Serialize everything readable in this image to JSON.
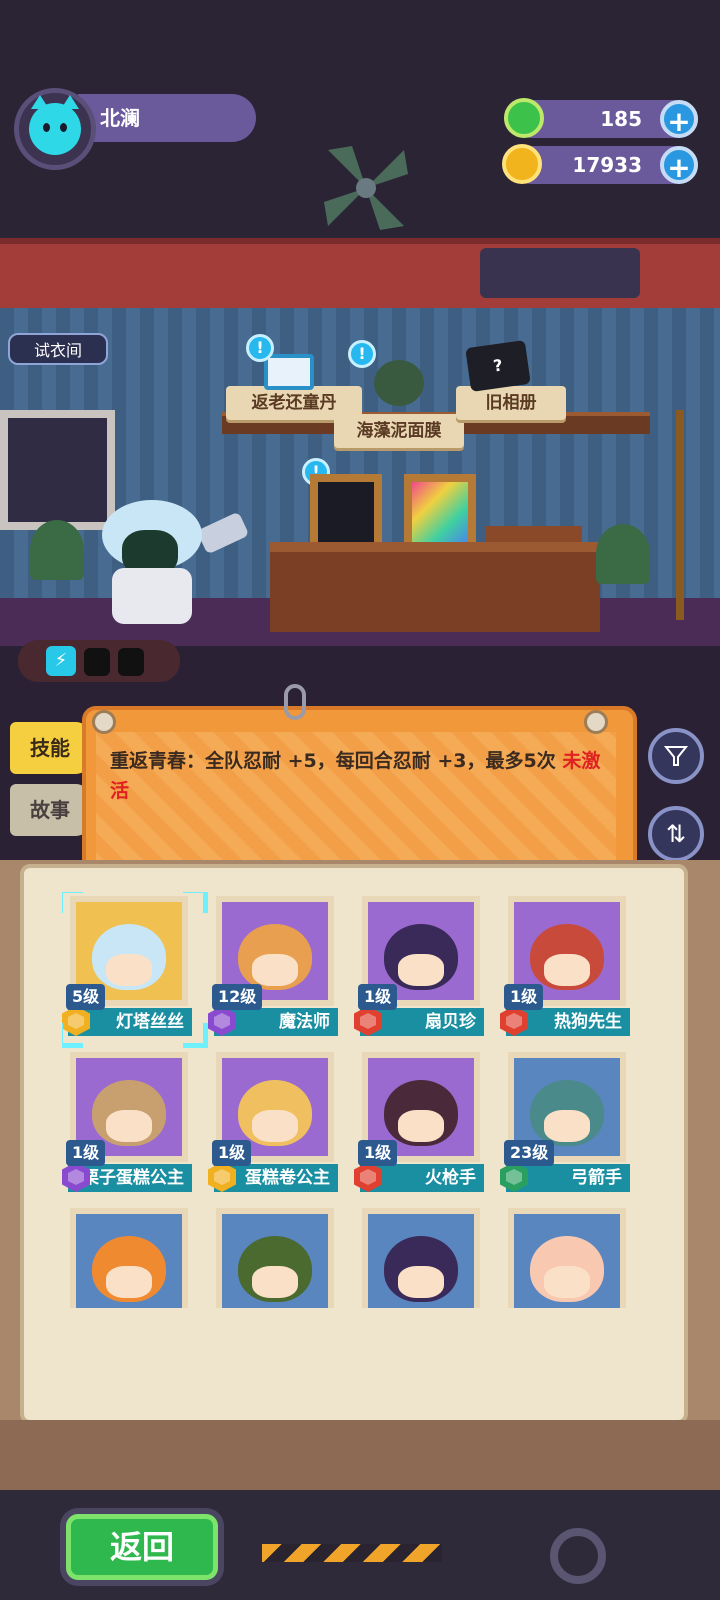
{
  "player": {
    "name": "北澜"
  },
  "currencies": [
    {
      "icon": "green-gem-icon",
      "value": "185"
    },
    {
      "icon": "planet-coin-icon",
      "value": "17933"
    }
  ],
  "scene": {
    "try_room_label": "试衣间",
    "items": [
      "返老还童丹",
      "海藻泥面膜",
      "旧相册"
    ]
  },
  "tabs": {
    "skill": "技能",
    "story": "故事"
  },
  "description": {
    "text": "重返青春：全队忍耐 +5，每回合忍耐 +3，最多5次",
    "status": "未激活",
    "status_color": "#e02020"
  },
  "characters": [
    {
      "level": "5级",
      "name": "灯塔丝丝",
      "rank_color": "#f0b020",
      "bg": "#f0c050",
      "hair": "#c8e6f5",
      "selected": true
    },
    {
      "level": "12级",
      "name": "魔法师",
      "rank_color": "#8a4ad0",
      "bg": "#9a6ad0",
      "hair": "#e8a050"
    },
    {
      "level": "1级",
      "name": "扇贝珍",
      "rank_color": "#e04030",
      "bg": "#9a6ad0",
      "hair": "#3a2a5a"
    },
    {
      "level": "1级",
      "name": "热狗先生",
      "rank_color": "#e04030",
      "bg": "#9a6ad0",
      "hair": "#c84a3a"
    },
    {
      "level": "1级",
      "name": "栗子蛋糕公主",
      "rank_color": "#8a4ad0",
      "bg": "#9a6ad0",
      "hair": "#c8a070"
    },
    {
      "level": "1级",
      "name": "蛋糕卷公主",
      "rank_color": "#f0b020",
      "bg": "#9a6ad0",
      "hair": "#f0c060"
    },
    {
      "level": "1级",
      "name": "火枪手",
      "rank_color": "#e04030",
      "bg": "#9a6ad0",
      "hair": "#4a2a3a"
    },
    {
      "level": "23级",
      "name": "弓箭手",
      "rank_color": "#2aa060",
      "bg": "#5a86c0",
      "hair": "#4a8a8a"
    },
    {
      "level": "",
      "name": "",
      "rank_color": "",
      "bg": "#5a86c0",
      "hair": "#f08a30"
    },
    {
      "level": "",
      "name": "",
      "rank_color": "",
      "bg": "#5a86c0",
      "hair": "#4a6a30"
    },
    {
      "level": "",
      "name": "",
      "rank_color": "",
      "bg": "#5a86c0",
      "hair": "#3a2a5a"
    },
    {
      "level": "",
      "name": "",
      "rank_color": "",
      "bg": "#5a86c0",
      "hair": "#f8c8b0"
    }
  ],
  "bottom": {
    "back_label": "返回"
  },
  "colors": {
    "accent_teal": "#1a8fa2",
    "tab_active": "#f5cf3f",
    "card_orange": "#f1983b",
    "back_green": "#2fb84e"
  }
}
